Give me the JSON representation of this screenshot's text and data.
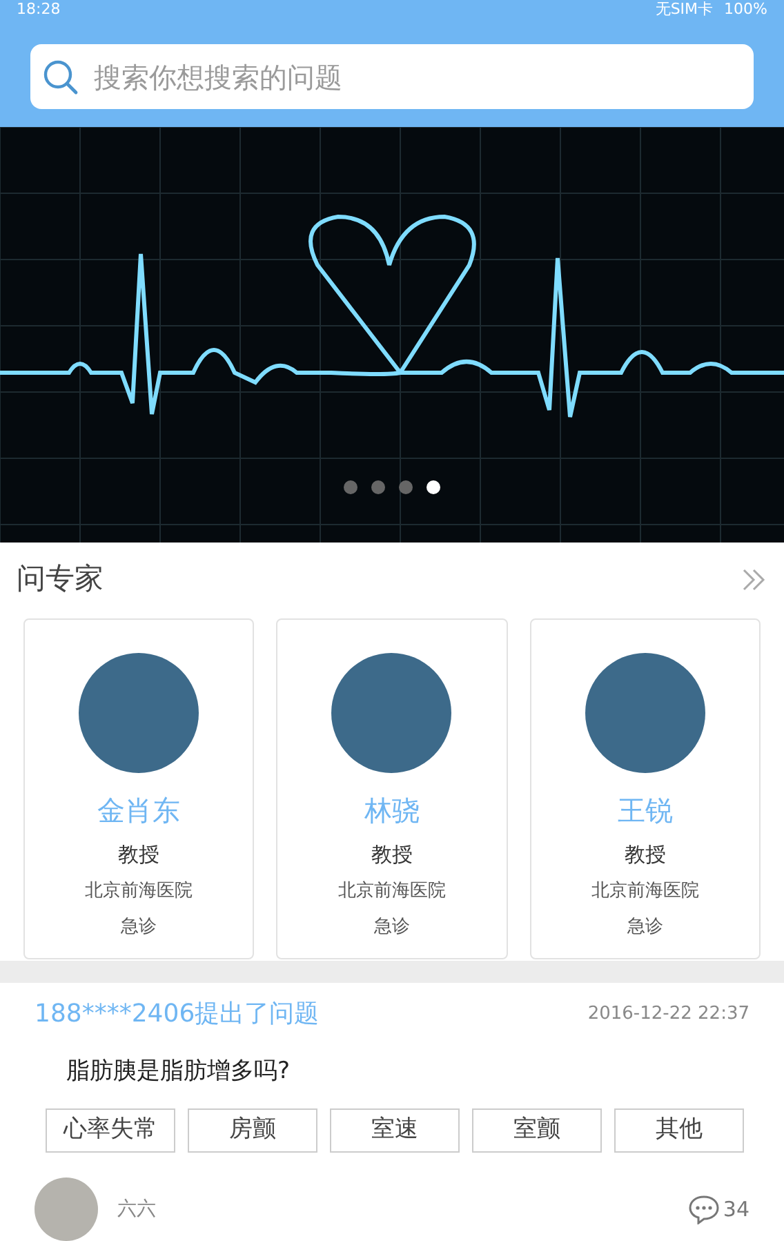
{
  "status_bar": {
    "time": "18:28",
    "carrier": "无SIM卡",
    "battery": "100%"
  },
  "search": {
    "placeholder": "搜索你想搜索的问题"
  },
  "banner": {
    "dots": [
      {
        "selected": false
      },
      {
        "selected": false
      },
      {
        "selected": false
      },
      {
        "selected": true
      }
    ]
  },
  "experts": {
    "title": "问专家",
    "cards": [
      {
        "name": "金肖东",
        "title": "教授",
        "hospital": "北京前海医院",
        "department": "急诊"
      },
      {
        "name": "林骁",
        "title": "教授",
        "hospital": "北京前海医院",
        "department": "急诊"
      },
      {
        "name": "王锐",
        "title": "教授",
        "hospital": "北京前海医院",
        "department": "急诊"
      }
    ]
  },
  "question": {
    "asker": "188****2406提出了问题",
    "time": "2016-12-22 22:37",
    "text": "脂肪胰是脂肪增多吗?",
    "tags": [
      "心率失常",
      "房颤",
      "室速",
      "室颤",
      "其他"
    ],
    "user": "六六",
    "comments": "34"
  }
}
